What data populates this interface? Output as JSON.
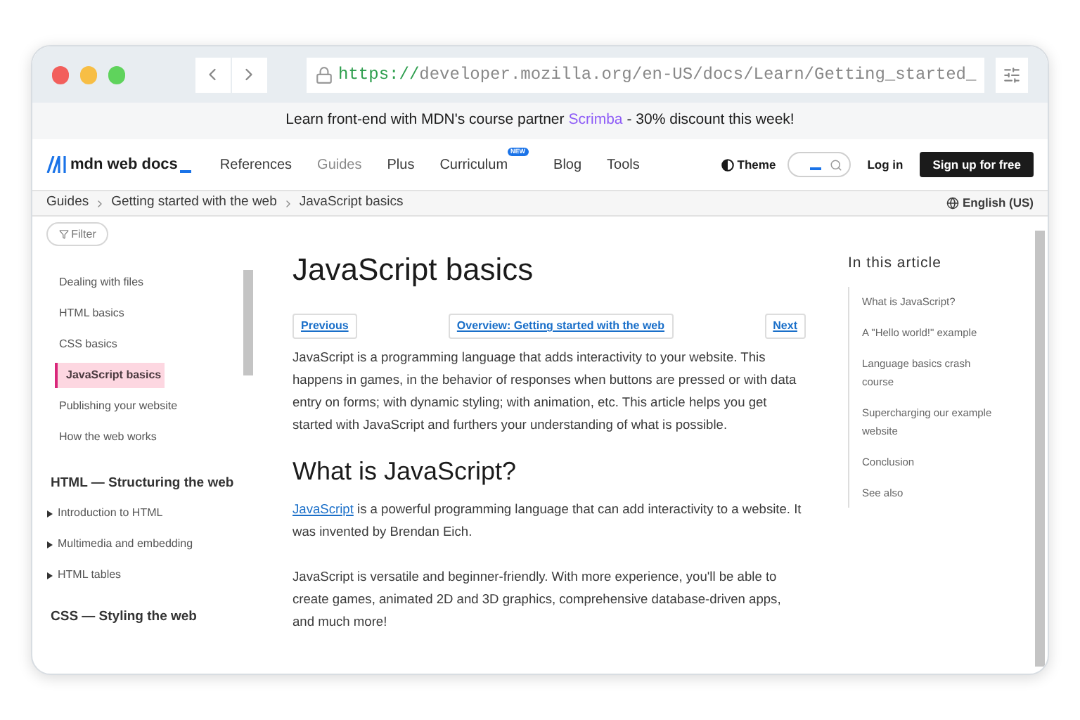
{
  "browser": {
    "url_scheme": "https://",
    "url_rest": "developer.mozilla.org/en-US/docs/Learn/Getting_started_"
  },
  "banner": {
    "before": "Learn front-end with MDN's course partner",
    "link": "Scrimba",
    "after": "- 30% discount this week!"
  },
  "header": {
    "logo": "mdn web docs",
    "nav": [
      {
        "label": "References",
        "selected": false
      },
      {
        "label": "Guides",
        "selected": true
      },
      {
        "label": "Plus",
        "selected": false
      },
      {
        "label": "Curriculum",
        "selected": false,
        "badge": "NEW"
      },
      {
        "label": "Blog",
        "selected": false
      },
      {
        "label": "Tools",
        "selected": false
      }
    ],
    "theme": "Theme",
    "login": "Log in",
    "signup": "Sign up for free"
  },
  "breadcrumbs": [
    "Guides",
    "Getting started with the web",
    "JavaScript basics"
  ],
  "language": "English (US)",
  "sidebar": {
    "filter": "Filter",
    "items": [
      {
        "label": "Dealing with files",
        "selected": false
      },
      {
        "label": "HTML basics",
        "selected": false
      },
      {
        "label": "CSS basics",
        "selected": false
      },
      {
        "label": "JavaScript basics",
        "selected": true
      },
      {
        "label": "Publishing your website",
        "selected": false
      },
      {
        "label": "How the web works",
        "selected": false
      }
    ],
    "sections": [
      {
        "title": "HTML — Structuring the web",
        "children": [
          {
            "label": "Introduction to HTML",
            "expanded": false
          },
          {
            "label": "Multimedia and embedding",
            "expanded": false
          },
          {
            "label": "HTML tables",
            "expanded": false
          }
        ]
      },
      {
        "title": "CSS — Styling the web"
      }
    ]
  },
  "article": {
    "title": "JavaScript basics",
    "prev": "Previous",
    "overview": "Overview: Getting started with the web",
    "next": "Next",
    "intro": "JavaScript is a programming language that adds interactivity to your website. This happens in games, in the behavior of responses when buttons are pressed or with data entry on forms; with dynamic styling; with animation, etc. This article helps you get started with JavaScript and furthers your understanding of what is possible.",
    "h2": "What is JavaScript?",
    "p1_link": "JavaScript",
    "p1_rest": "is a powerful programming language that can add interactivity to a website. It was invented by Brendan Eich.",
    "p2": "JavaScript is versatile and beginner-friendly. With more experience, you'll be able to create games, animated 2D and 3D graphics, comprehensive database-driven apps, and much more!"
  },
  "toc": {
    "title": "In this article",
    "items": [
      "What is JavaScript?",
      "A \"Hello world!\" example",
      "Language basics crash course",
      "Supercharging our example website",
      "Conclusion",
      "See also"
    ]
  }
}
